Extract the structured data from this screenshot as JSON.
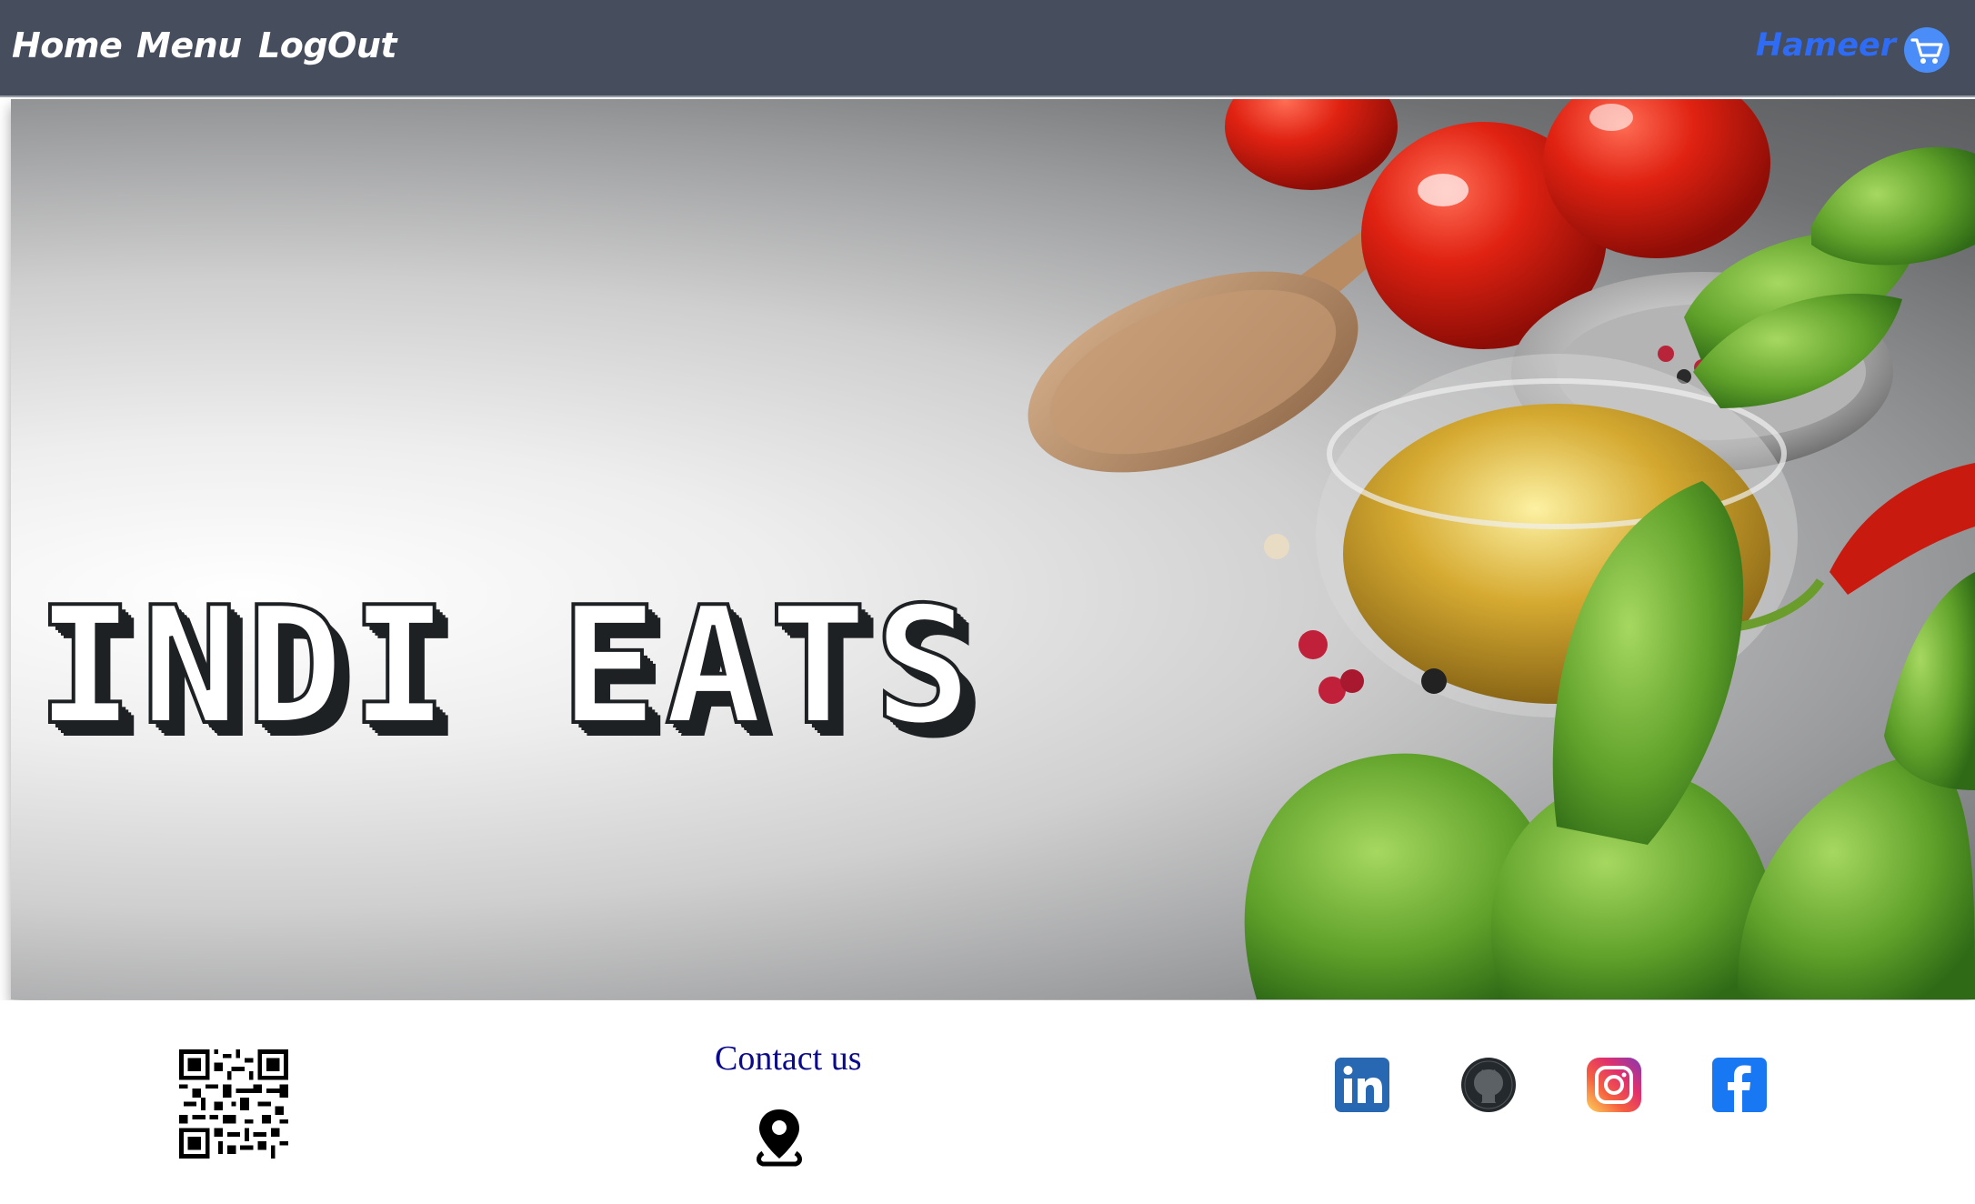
{
  "nav": {
    "home": "Home",
    "menu": "Menu",
    "logout": "LogOut",
    "user": "Hameer",
    "cart_icon": "cart-icon"
  },
  "hero": {
    "title": "INDI EATS",
    "image_icon": "food-ingredients-image"
  },
  "footer": {
    "qr_icon": "qr-code-icon",
    "contact_title": "Contact us",
    "location_icon": "location-pin-icon",
    "social": [
      "linkedin-icon",
      "github-icon",
      "instagram-icon",
      "facebook-icon"
    ]
  },
  "colors": {
    "navbar_bg": "#464d5c",
    "user_text": "#2f6cf6",
    "cart_bg": "#4a8df8",
    "contact_text": "#0a0a8a",
    "linkedin": "#2867b2",
    "github": "#24292e",
    "facebook": "#1877f2"
  }
}
